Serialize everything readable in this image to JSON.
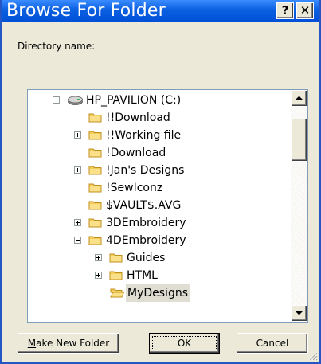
{
  "window": {
    "title": "Browse For Folder",
    "help_glyph": "?",
    "close_glyph": "✕"
  },
  "dialog": {
    "directory_label": "Directory name:"
  },
  "tree": {
    "items": [
      {
        "label": "HP_PAVILION (C:)",
        "icon": "drive-icon",
        "expander": "minus"
      },
      {
        "label": "!!Download",
        "icon": "folder-icon",
        "expander": "none"
      },
      {
        "label": "!!Working file",
        "icon": "folder-icon",
        "expander": "plus"
      },
      {
        "label": "!Download",
        "icon": "folder-icon",
        "expander": "none"
      },
      {
        "label": "!Jan's Designs",
        "icon": "folder-icon",
        "expander": "plus"
      },
      {
        "label": "!SewIconz",
        "icon": "folder-icon",
        "expander": "none"
      },
      {
        "label": "$VAULT$.AVG",
        "icon": "folder-icon",
        "expander": "none"
      },
      {
        "label": "3DEmbroidery",
        "icon": "folder-icon",
        "expander": "plus"
      },
      {
        "label": "4DEmbroidery",
        "icon": "folder-icon",
        "expander": "minus"
      },
      {
        "label": "Guides",
        "icon": "folder-icon",
        "expander": "plus"
      },
      {
        "label": "HTML",
        "icon": "folder-icon",
        "expander": "plus"
      },
      {
        "label": "MyDesigns",
        "icon": "folder-open-icon",
        "expander": "none",
        "selected": true
      }
    ]
  },
  "buttons": {
    "new_folder_mnemonic": "M",
    "new_folder_rest": "ake New Folder",
    "ok": "OK",
    "cancel": "Cancel"
  }
}
